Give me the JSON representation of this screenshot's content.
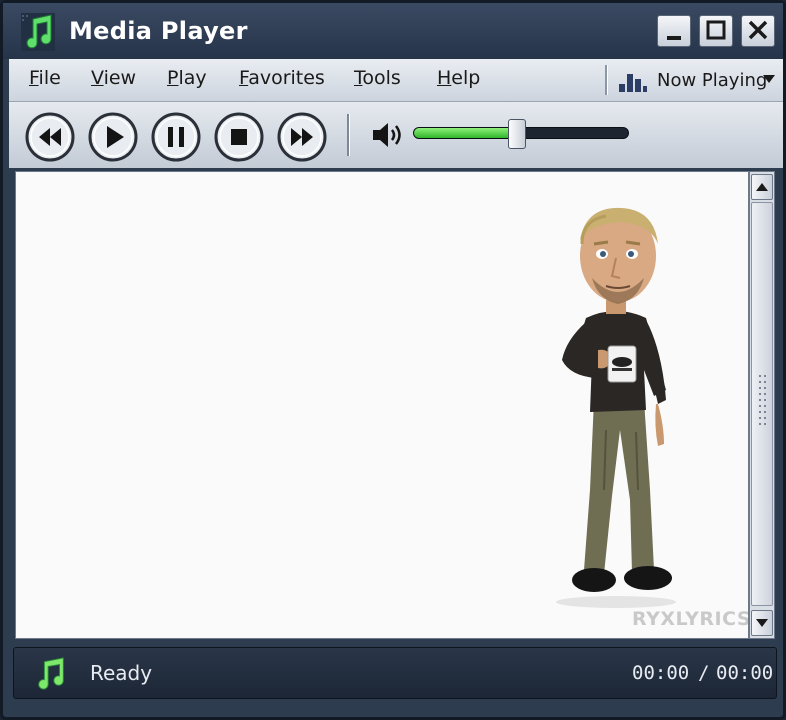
{
  "window": {
    "title": "Media Player"
  },
  "menu": {
    "items": [
      {
        "label": "File",
        "accel": "F",
        "rest": "ile"
      },
      {
        "label": "View",
        "accel": "V",
        "rest": "iew"
      },
      {
        "label": "Play",
        "accel": "P",
        "rest": "lay"
      },
      {
        "label": "Favorites",
        "accel": "F",
        "rest": "avorites"
      },
      {
        "label": "Tools",
        "accel": "T",
        "rest": "ools"
      },
      {
        "label": "Help",
        "accel": "H",
        "rest": "elp"
      }
    ],
    "now_playing": "Now Playing"
  },
  "transport": {
    "buttons": [
      "rewind-icon",
      "play-icon",
      "pause-icon",
      "stop-icon",
      "fast-forward-icon"
    ],
    "volume_level": 0.48
  },
  "video": {
    "watermark": "RYXLYRICS"
  },
  "status": {
    "text": "Ready",
    "elapsed": "00:00",
    "separator": "/",
    "total": "00:00"
  },
  "colors": {
    "frame": "#2e3c50",
    "accent": "#2fb52a",
    "panel": "#dce1e8"
  }
}
